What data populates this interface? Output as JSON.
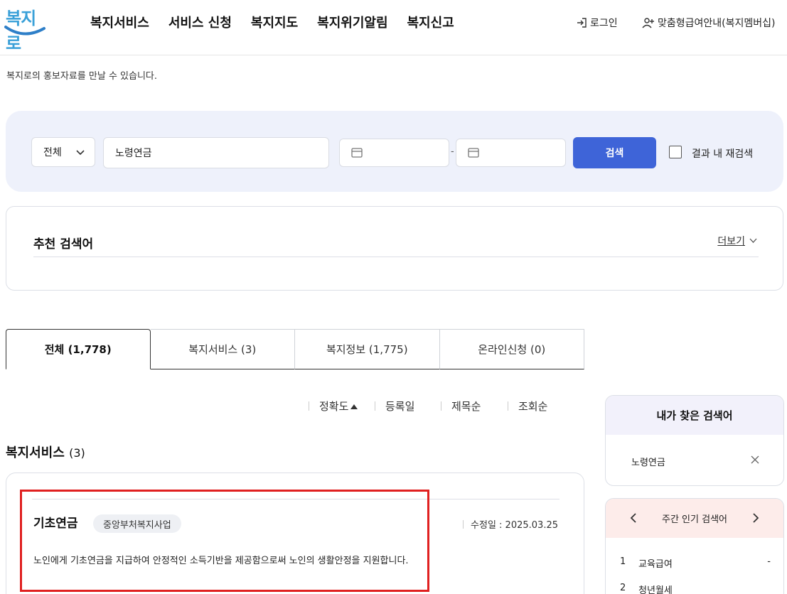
{
  "header": {
    "logo": "복지로",
    "nav": [
      "복지서비스",
      "서비스 신청",
      "복지지도",
      "복지위기알림",
      "복지신고"
    ],
    "login": "로그인",
    "member": "맞춤형급여안내(복지멤버십)"
  },
  "page": {
    "subtitle": "복지로의 홍보자료를 만날 수 있습니다."
  },
  "search": {
    "category": "전체",
    "keyword": "노령연금",
    "date_separator": "-",
    "button": "검색",
    "research_label": "결과 내 재검색"
  },
  "recommend": {
    "title": "추천 검색어",
    "more": "더보기"
  },
  "tabs": [
    {
      "label": "전체 (1,778)"
    },
    {
      "label": "복지서비스 (3)"
    },
    {
      "label": "복지정보 (1,775)"
    },
    {
      "label": "온라인신청 (0)"
    }
  ],
  "sort": {
    "accuracy": "정확도",
    "registered": "등록일",
    "title": "제목순",
    "views": "조회순"
  },
  "section": {
    "title": "복지서비스",
    "count": "(3)"
  },
  "result": {
    "title": "기초연금",
    "tag": "중앙부처복지사업",
    "date": "수정일 : 2025.03.25",
    "description": "노인에게 기초연금을 지급하여 안정적인 소득기반을 제공함으로써 노인의 생활안정을 지원합니다."
  },
  "my_search": {
    "title": "내가 찾은 검색어",
    "items": [
      "노령연금"
    ]
  },
  "popular": {
    "title": "주간 인기 검색어",
    "items": [
      {
        "rank": "1",
        "word": "교육급여",
        "change": "-"
      },
      {
        "rank": "2",
        "word": "청년월세",
        "change": ""
      }
    ]
  },
  "colors": {
    "primary": "#3e64d8",
    "highlight": "#e02020",
    "panel": "#eef1fb"
  }
}
